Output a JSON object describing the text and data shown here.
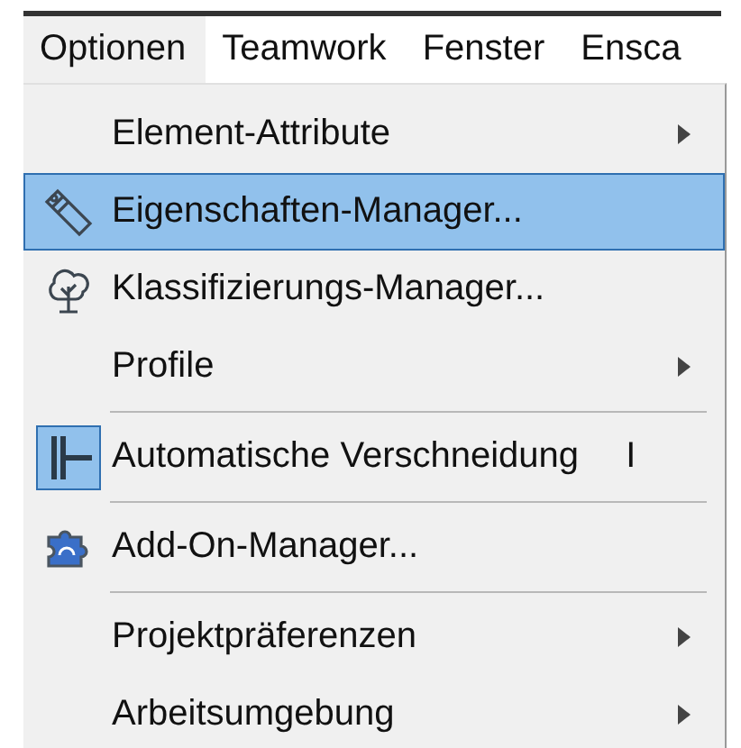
{
  "menubar": [
    {
      "label": "Optionen",
      "selected": true
    },
    {
      "label": "Teamwork",
      "selected": false
    },
    {
      "label": "Fenster",
      "selected": false
    },
    {
      "label": "Ensca",
      "selected": false
    }
  ],
  "menu": [
    {
      "kind": "plain",
      "label": "Element-Attribute",
      "submenu": true,
      "selected": false,
      "checked": false
    },
    {
      "kind": "tag",
      "label": "Eigenschaften-Manager...",
      "submenu": false,
      "selected": true,
      "checked": false
    },
    {
      "kind": "tree",
      "label": "Klassifizierungs-Manager...",
      "submenu": false,
      "selected": false,
      "checked": false
    },
    {
      "kind": "plain",
      "label": "Profile",
      "submenu": true,
      "selected": false,
      "checked": false
    },
    {
      "kind": "separator"
    },
    {
      "kind": "junction",
      "label": "Automatische Verschneidung",
      "shortcut": "I",
      "submenu": false,
      "selected": false,
      "checked": true
    },
    {
      "kind": "separator"
    },
    {
      "kind": "puzzle",
      "label": "Add-On-Manager...",
      "submenu": false,
      "selected": false,
      "checked": false
    },
    {
      "kind": "separator"
    },
    {
      "kind": "plain",
      "label": "Projektpräferenzen",
      "submenu": true,
      "selected": false,
      "checked": false
    },
    {
      "kind": "plain",
      "label": "Arbeitsumgebung",
      "submenu": true,
      "selected": false,
      "checked": false
    }
  ]
}
